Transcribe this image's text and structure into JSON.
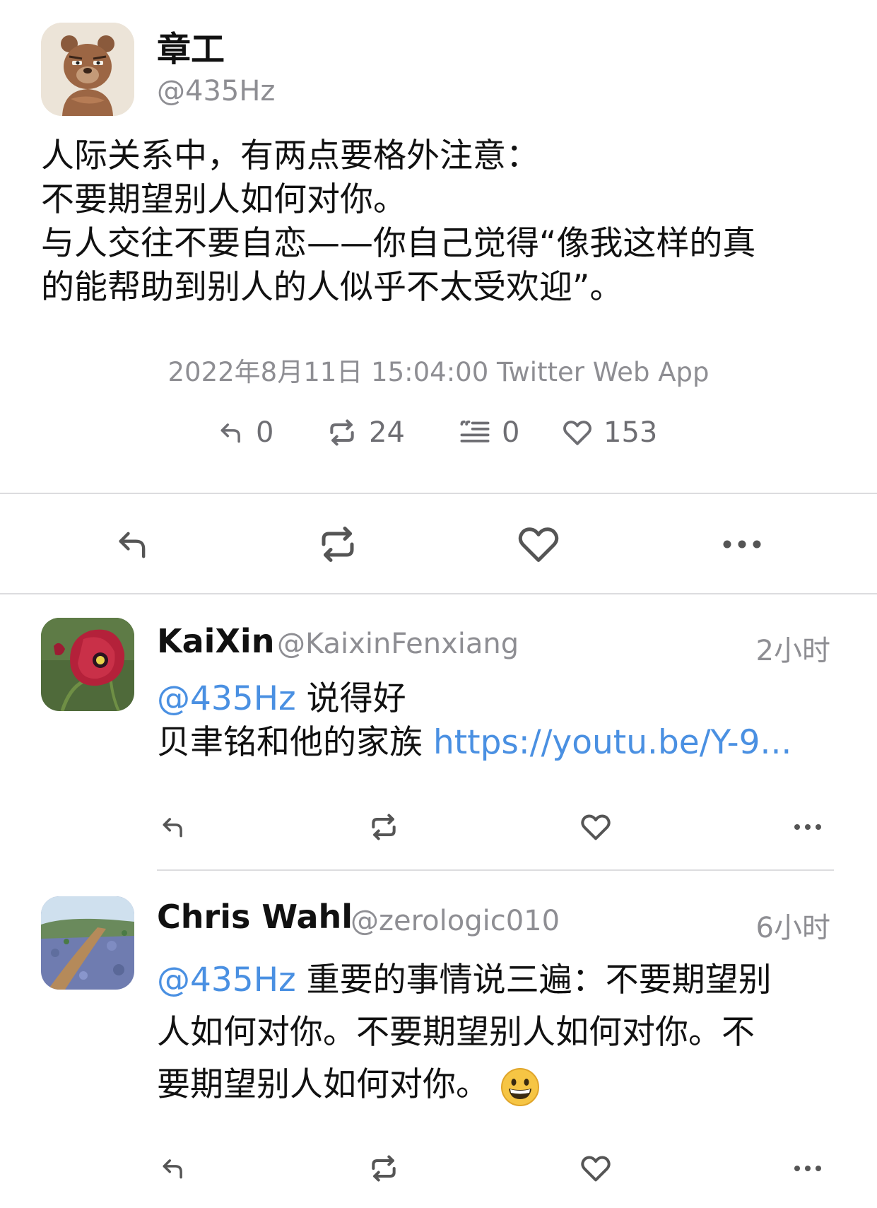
{
  "tweet": {
    "author_name": "章工",
    "author_handle": "@435Hz",
    "avatar_icon": "bear-avatar-icon",
    "text_lines": [
      "人际关系中，有两点要格外注意：",
      "不要期望别人如何对你。",
      "与人交往不要自恋——你自己觉得“像我这样的真",
      "的能帮助到别人的人似乎不太受欢迎”。"
    ],
    "meta": "2022年8月11日 15:04:00 Twitter Web App",
    "stats": {
      "replies": "0",
      "retweets": "24",
      "quotes": "0",
      "likes": "153"
    }
  },
  "actions": [
    "reply",
    "retweet",
    "like",
    "more"
  ],
  "replies": [
    {
      "name": "KaiXin",
      "handle": "@KaixinFenxiang",
      "time": "2小时",
      "avatar_icon": "poppy-flower-avatar-icon",
      "mention": "@435Hz",
      "text_after_mention": " 说得好",
      "line2_text": "贝聿铭和他的家族 ",
      "link": "https://youtu.be/Y-9..."
    },
    {
      "name": "Chris Wahl",
      "handle": "@zerologic010",
      "time": "6小时",
      "avatar_icon": "lavender-field-avatar-icon",
      "mention": "@435Hz",
      "line1_rest": " 重要的事情说三遍：不要期望别",
      "line2": "人如何对你。不要期望别人如何对你。不",
      "line3": "要期望别人如何对你。",
      "emoji_icon": "grinning-face-emoji-icon"
    }
  ],
  "colors": {
    "link": "#4a90e2",
    "secondary_text": "#8e8e93",
    "divider": "#dcdcdf"
  }
}
